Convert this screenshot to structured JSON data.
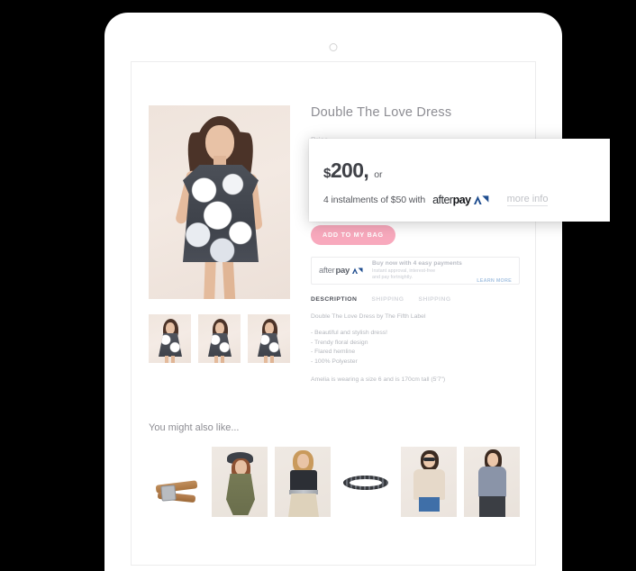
{
  "device": {
    "camera_icon": "camera-dot-icon"
  },
  "product": {
    "title": "Double The Love Dress",
    "price_label": "Price",
    "add_to_bag_label": "ADD TO MY BAG",
    "main_image_alt": "model-wearing-floral-dress",
    "thumbnails": [
      {
        "alt": "front-view-thumbnail"
      },
      {
        "alt": "three-quarter-view-thumbnail"
      },
      {
        "alt": "side-view-thumbnail"
      }
    ]
  },
  "afterpay_banner": {
    "logo_after": "after",
    "logo_pay": "pay",
    "logo_mark_icon": "afterpay-chevron-icon",
    "headline": "Buy now with 4 easy payments",
    "sub_line_1": "Instant approval, interest-free",
    "sub_line_2": "and pay fortnightly.",
    "learn_more_label": "LEARN MORE"
  },
  "tabs": [
    {
      "label": "DESCRIPTION",
      "active": true
    },
    {
      "label": "SHIPPING",
      "active": false
    },
    {
      "label": "SHIPPING",
      "active": false
    }
  ],
  "description": {
    "intro": "Double The Love Dress by The Fifth Label",
    "bullets": [
      "- Beautiful and stylish dress!",
      "- Trendy floral design",
      "- Flared hemline",
      "- 100% Polyester"
    ],
    "note": "Amelia is wearing a size 6 and is 170cm tall (5'7\")"
  },
  "also_like": {
    "title": "You might also like...",
    "items": [
      {
        "alt": "leather-belt-product"
      },
      {
        "alt": "khaki-romper-product"
      },
      {
        "alt": "button-front-skirt-product"
      },
      {
        "alt": "beaded-bracelet-product"
      },
      {
        "alt": "knit-sweater-product"
      },
      {
        "alt": "grey-turtleneck-top-product"
      }
    ]
  },
  "price_popup": {
    "currency": "$",
    "amount": "200,",
    "or_label": "or",
    "instalment_text": "4 instalments of $50 with",
    "logo_after": "after",
    "logo_pay": "pay",
    "logo_mark_icon": "afterpay-chevron-icon",
    "more_info_label": "more info"
  },
  "colors": {
    "accent_pink": "#f8a9bd",
    "afterpay_blue": "#1f4d8f",
    "text_grey": "#8d8d93",
    "muted_grey": "#b4b7bd"
  }
}
